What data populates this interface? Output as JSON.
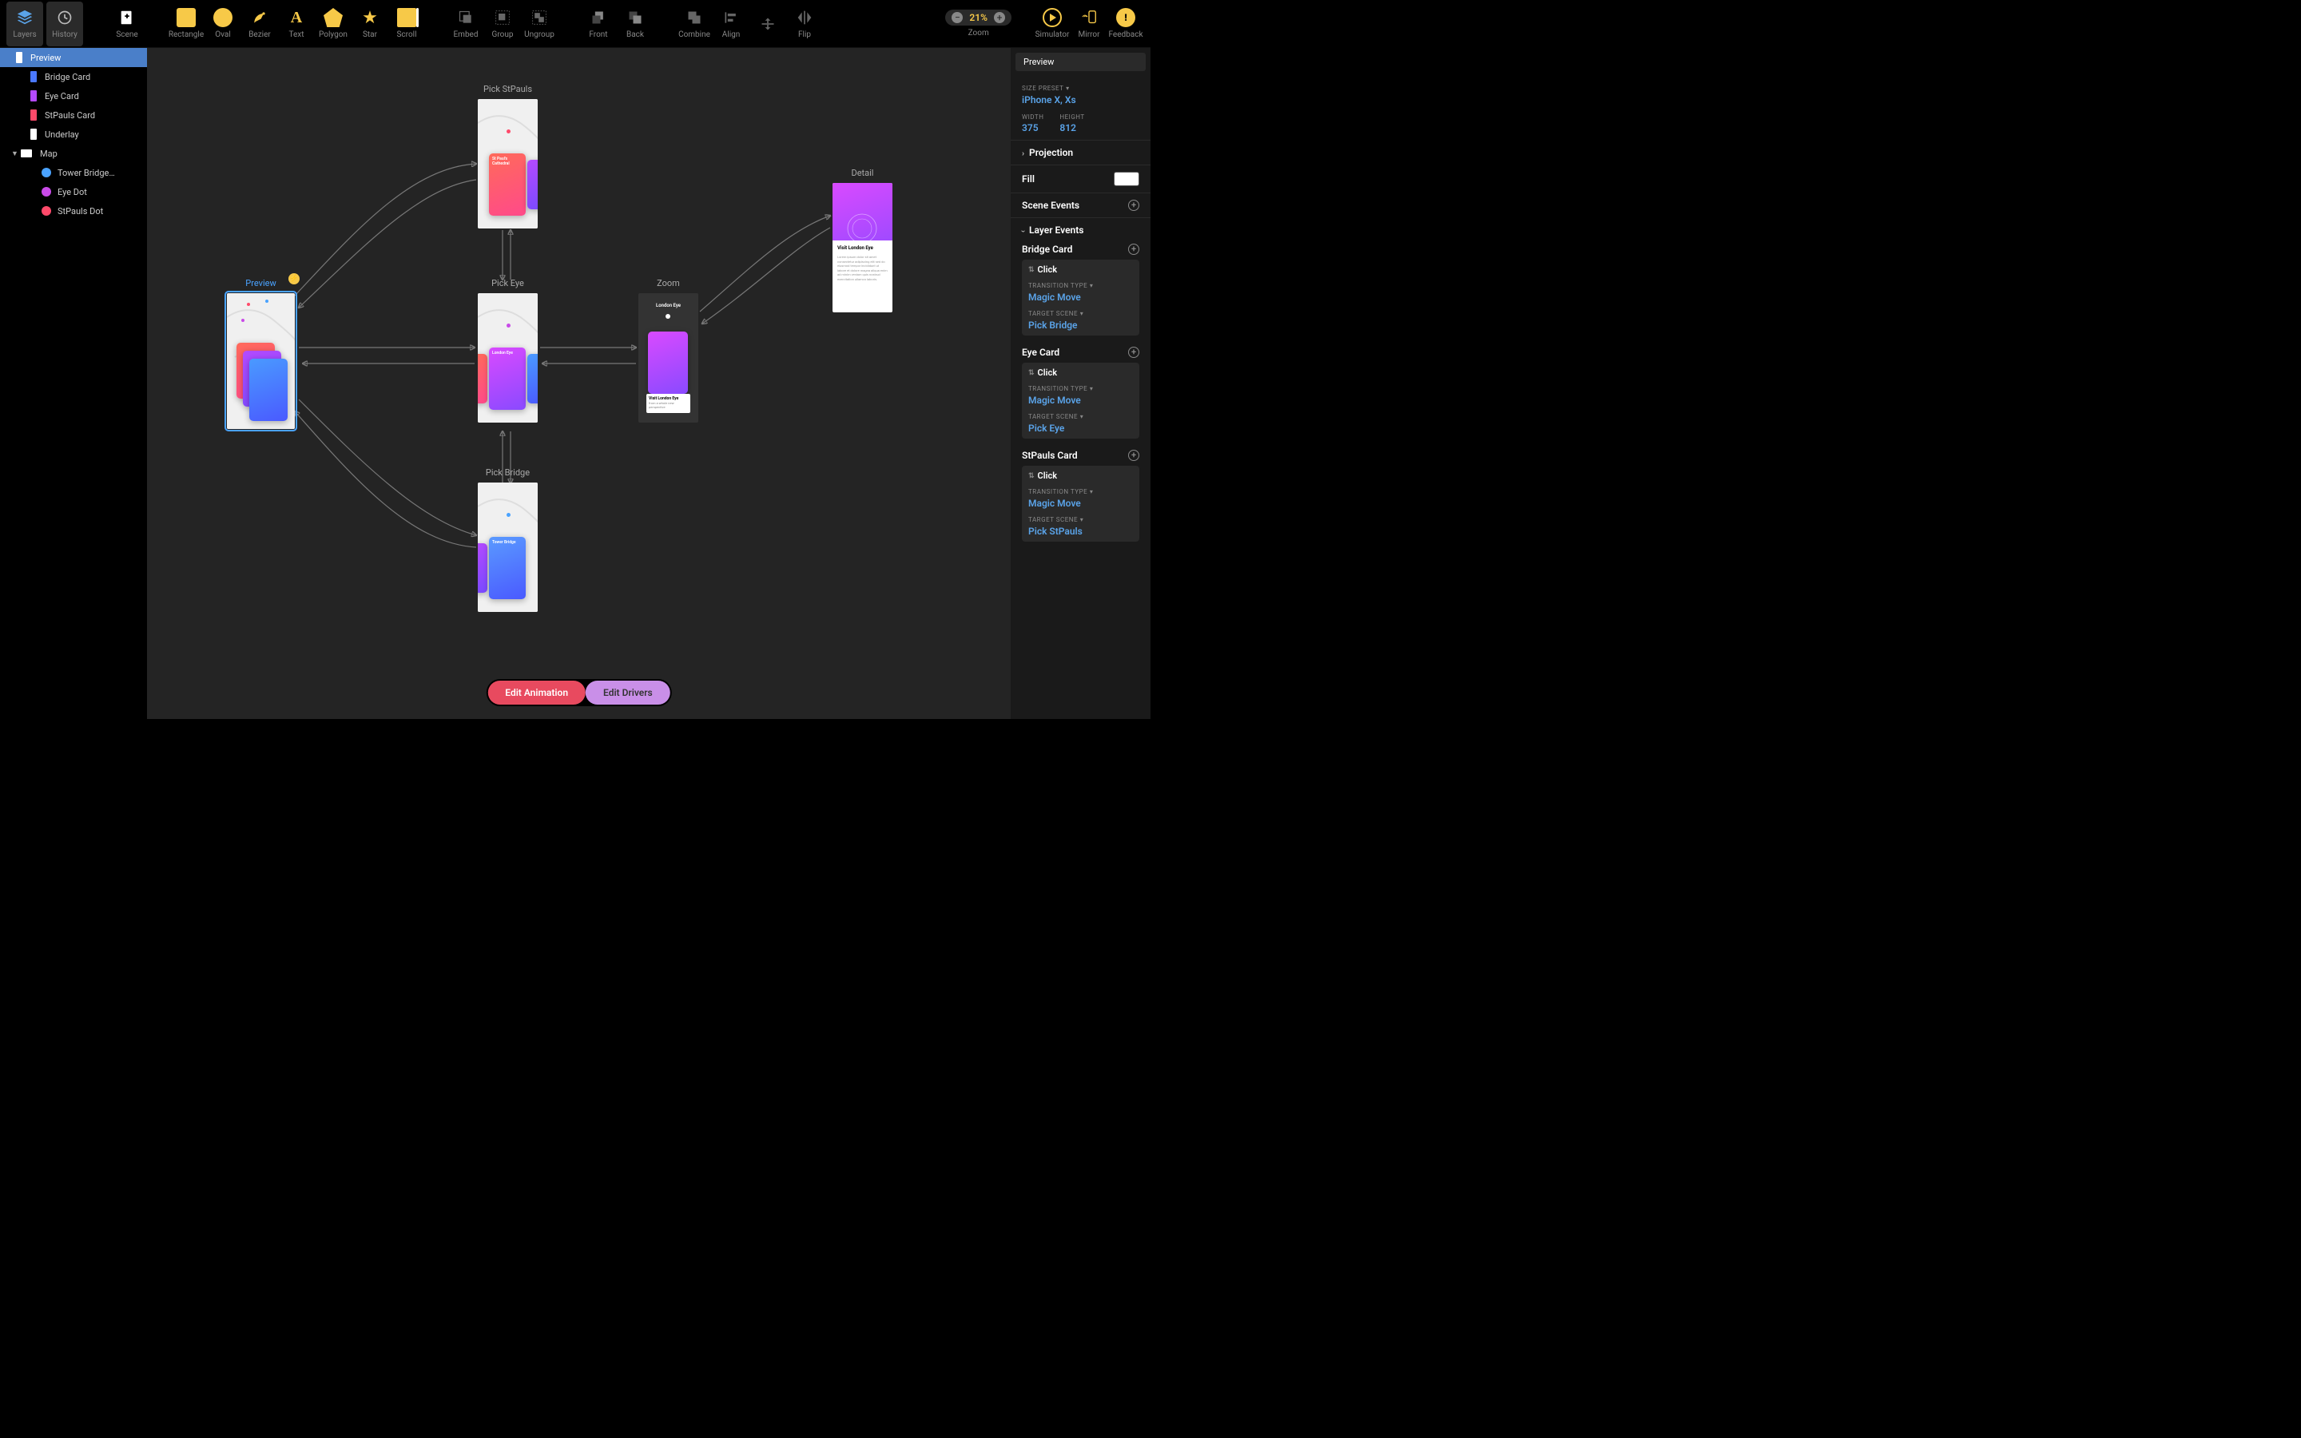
{
  "toolbar": {
    "layers": "Layers",
    "history": "History",
    "scene": "Scene",
    "rectangle": "Rectangle",
    "oval": "Oval",
    "bezier": "Bezier",
    "text": "Text",
    "polygon": "Polygon",
    "star": "Star",
    "scroll": "Scroll",
    "embed": "Embed",
    "group": "Group",
    "ungroup": "Ungroup",
    "front": "Front",
    "back": "Back",
    "combine": "Combine",
    "align": "Align",
    "flip": "Flip",
    "zoom": "Zoom",
    "zoom_value": "21%",
    "simulator": "Simulator",
    "mirror": "Mirror",
    "feedback": "Feedback"
  },
  "layers": {
    "items": [
      {
        "name": "Preview",
        "color": "#ffffff",
        "sel": true
      },
      {
        "name": "Bridge Card",
        "color": "#4a78ff"
      },
      {
        "name": "Eye Card",
        "color": "#b44aff"
      },
      {
        "name": "StPauls Card",
        "color": "#ff4a6a"
      },
      {
        "name": "Underlay",
        "color": "#ffffff"
      },
      {
        "name": "Map",
        "color": "#ffffff",
        "expandable": true
      },
      {
        "name": "Tower Bridge…",
        "dot": "#4aa3ff",
        "child": true
      },
      {
        "name": "Eye Dot",
        "dot": "#c94ae8",
        "child": true
      },
      {
        "name": "StPauls Dot",
        "dot": "#ff4a6a",
        "child": true
      }
    ]
  },
  "scenes": {
    "preview": {
      "title": "Preview"
    },
    "pick_stpauls": {
      "title": "Pick StPauls",
      "card": "St Paul's Cathedral"
    },
    "pick_eye": {
      "title": "Pick Eye",
      "card": "London Eye"
    },
    "pick_bridge": {
      "title": "Pick Bridge",
      "card": "Tower Bridge"
    },
    "zoom": {
      "title": "Zoom",
      "header": "London Eye",
      "visit": "Visit London Eye",
      "sub": "from a whole new perspective"
    },
    "detail": {
      "title": "Detail",
      "visit": "Visit London Eye"
    }
  },
  "inspector": {
    "title": "Preview",
    "size_preset_lbl": "SIZE PRESET",
    "size_preset": "iPhone X, Xs",
    "width_lbl": "WIDTH",
    "width": "375",
    "height_lbl": "HEIGHT",
    "height": "812",
    "projection": "Projection",
    "fill": "Fill",
    "scene_events": "Scene Events",
    "layer_events": "Layer Events",
    "events": [
      {
        "layer": "Bridge Card",
        "trigger": "Click",
        "tt_lbl": "TRANSITION TYPE",
        "tt": "Magic Move",
        "ts_lbl": "TARGET SCENE",
        "ts": "Pick Bridge"
      },
      {
        "layer": "Eye Card",
        "trigger": "Click",
        "tt_lbl": "TRANSITION TYPE",
        "tt": "Magic Move",
        "ts_lbl": "TARGET SCENE",
        "ts": "Pick Eye"
      },
      {
        "layer": "StPauls Card",
        "trigger": "Click",
        "tt_lbl": "TRANSITION TYPE",
        "tt": "Magic Move",
        "ts_lbl": "TARGET SCENE",
        "ts": "Pick StPauls"
      }
    ]
  },
  "bottom": {
    "anim": "Edit Animation",
    "drv": "Edit Drivers"
  }
}
